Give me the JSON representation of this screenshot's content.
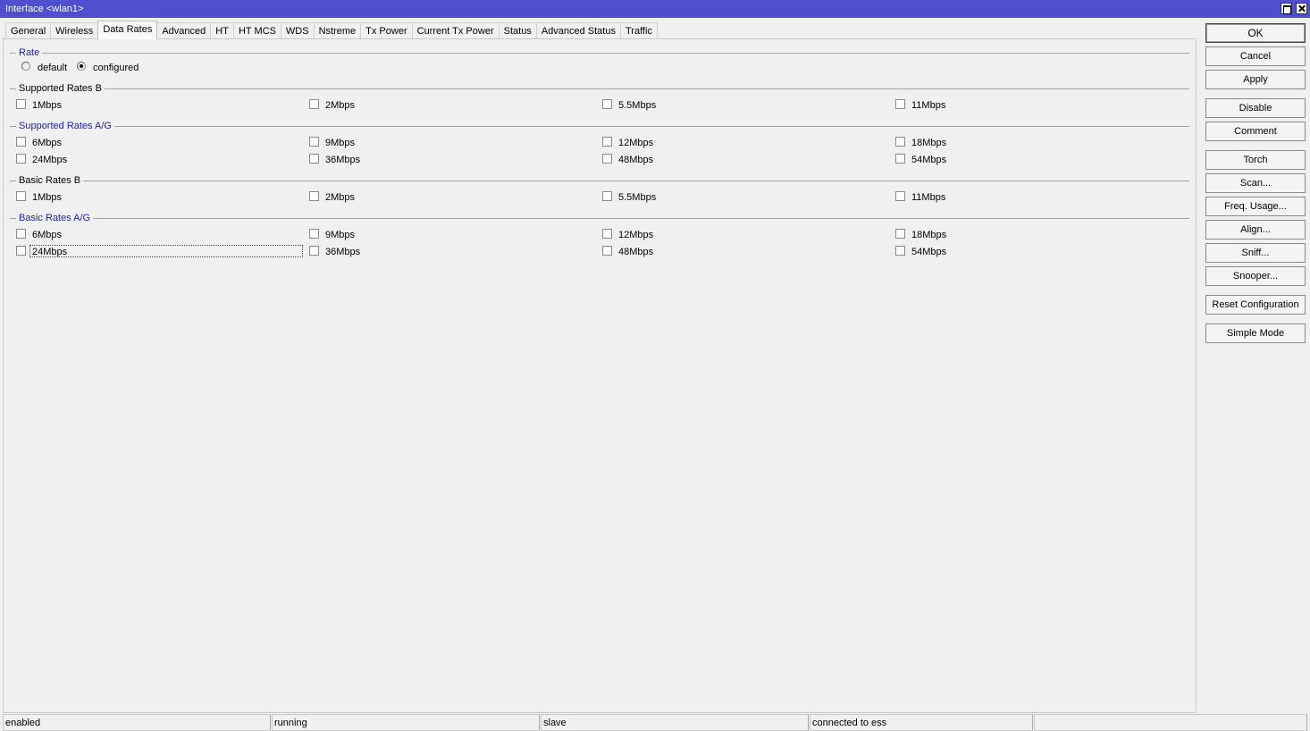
{
  "window": {
    "title": "Interface <wlan1>"
  },
  "tabs": [
    "General",
    "Wireless",
    "Data Rates",
    "Advanced",
    "HT",
    "HT MCS",
    "WDS",
    "Nstreme",
    "Tx Power",
    "Current Tx Power",
    "Status",
    "Advanced Status",
    "Traffic"
  ],
  "active_tab": "Data Rates",
  "rate": {
    "title": "Rate",
    "options": [
      "default",
      "configured"
    ],
    "selected": "configured"
  },
  "groups": [
    {
      "title": "Supported Rates B",
      "rows": [
        [
          "1Mbps",
          "2Mbps",
          "5.5Mbps",
          "11Mbps"
        ]
      ]
    },
    {
      "title": "Supported Rates A/G",
      "rows": [
        [
          "6Mbps",
          "9Mbps",
          "12Mbps",
          "18Mbps"
        ],
        [
          "24Mbps",
          "36Mbps",
          "48Mbps",
          "54Mbps"
        ]
      ]
    },
    {
      "title": "Basic Rates B",
      "rows": [
        [
          "1Mbps",
          "2Mbps",
          "5.5Mbps",
          "11Mbps"
        ]
      ]
    },
    {
      "title": "Basic Rates A/G",
      "rows": [
        [
          "6Mbps",
          "9Mbps",
          "12Mbps",
          "18Mbps"
        ],
        [
          "24Mbps",
          "36Mbps",
          "48Mbps",
          "54Mbps"
        ]
      ]
    }
  ],
  "buttons": [
    "OK",
    "Cancel",
    "Apply",
    "Disable",
    "Comment",
    "Torch",
    "Scan...",
    "Freq. Usage...",
    "Align...",
    "Sniff...",
    "Snooper...",
    "Reset Configuration",
    "Simple Mode"
  ],
  "status": [
    "enabled",
    "running",
    "slave",
    "connected to ess",
    ""
  ],
  "colors": {
    "titlebar": "#4f4fcf",
    "group_title_blue": "#2020c8"
  }
}
